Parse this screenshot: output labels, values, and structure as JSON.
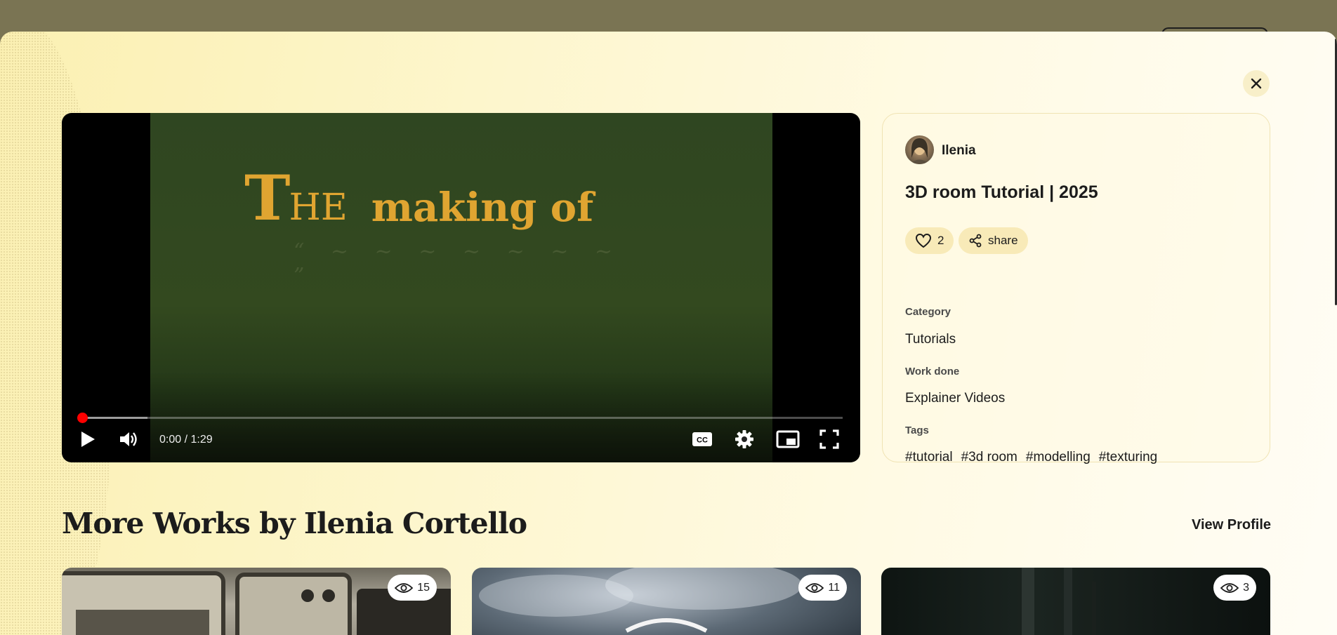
{
  "video": {
    "time": "0:00 / 1:29",
    "played_fraction": 0.005,
    "buffered_fraction": 0.09,
    "art_title_big": "T",
    "art_title_he": "HE",
    "art_title_rest": "making of",
    "art_subtitle": "“ ~ ~ ~ ~ ~ ~ ~ ”"
  },
  "work": {
    "author": "Ilenia",
    "title": "3D room Tutorial | 2025",
    "likes": "2",
    "share_label": "share",
    "category_label": "Category",
    "category": "Tutorials",
    "work_done_label": "Work done",
    "work_done": "Explainer Videos",
    "tags_label": "Tags",
    "tags": [
      "#tutorial",
      "#3d room",
      "#modelling",
      "#texturing"
    ]
  },
  "more": {
    "heading": "More Works by Ilenia Cortello",
    "view_profile": "View Profile",
    "cards": [
      {
        "views": "15"
      },
      {
        "views": "11"
      },
      {
        "views": "3"
      }
    ]
  },
  "colors": {
    "accent": "#ff0000",
    "pill": "#f8eab8",
    "backdrop": "#7a7453"
  }
}
